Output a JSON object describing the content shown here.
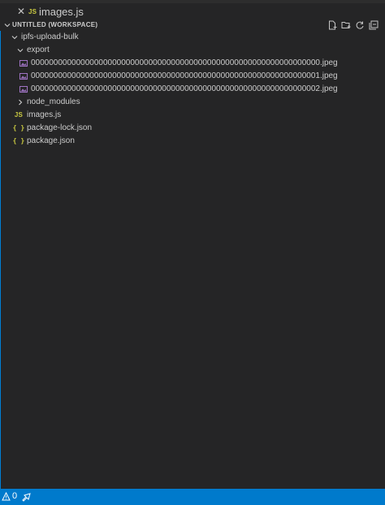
{
  "open_editors": {
    "file_badge": "JS",
    "file_name": "images.js"
  },
  "explorer": {
    "workspace_title": "UNTITLED (WORKSPACE)",
    "actions": [
      "new-file-icon",
      "new-folder-icon",
      "refresh-icon",
      "collapse-all-icon"
    ],
    "tree": [
      {
        "label": "ipfs-upload-bulk",
        "kind": "folder",
        "expanded": true,
        "depth": 0
      },
      {
        "label": "export",
        "kind": "folder",
        "expanded": true,
        "depth": 1
      },
      {
        "label": "0000000000000000000000000000000000000000000000000000000000000000.jpeg",
        "kind": "image",
        "depth": 2
      },
      {
        "label": "0000000000000000000000000000000000000000000000000000000000000001.jpeg",
        "kind": "image",
        "depth": 2
      },
      {
        "label": "0000000000000000000000000000000000000000000000000000000000000002.jpeg",
        "kind": "image",
        "depth": 2
      },
      {
        "label": "node_modules",
        "kind": "folder",
        "expanded": false,
        "depth": 1
      },
      {
        "label": "images.js",
        "kind": "js",
        "badge": "JS",
        "depth": 1
      },
      {
        "label": "package-lock.json",
        "kind": "json",
        "badge": "{ }",
        "depth": 1
      },
      {
        "label": "package.json",
        "kind": "json",
        "badge": "{ }",
        "depth": 1
      }
    ]
  },
  "statusbar": {
    "problems_count": "0"
  },
  "colors": {
    "sidebar_bg": "#252526",
    "accent": "#007acc",
    "focus_border": "#007fd4",
    "js_badge": "#cbcb41",
    "image_icon": "#a074c4"
  }
}
